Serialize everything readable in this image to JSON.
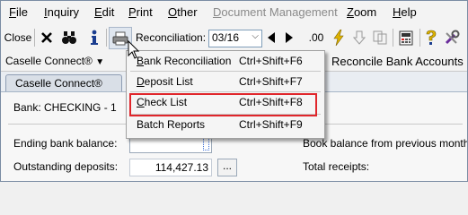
{
  "menubar": {
    "items": [
      {
        "label": "File",
        "u": "F",
        "rest": "ile"
      },
      {
        "label": "Inquiry",
        "u": "I",
        "rest": "nquiry"
      },
      {
        "label": "Edit",
        "u": "E",
        "rest": "dit"
      },
      {
        "label": "Print",
        "u": "P",
        "rest": "rint"
      },
      {
        "label": "Other",
        "u": "O",
        "rest": "ther"
      },
      {
        "label": "Document Management",
        "u": "D",
        "rest": "ocument Management"
      },
      {
        "label": "Zoom",
        "u": "Z",
        "rest": "oom"
      },
      {
        "label": "Help",
        "u": "H",
        "rest": "elp"
      }
    ]
  },
  "toolbar": {
    "close_label": "Close",
    "reconciliation_label": "Reconciliation:",
    "reconciliation_value": "03/16",
    "decimal_label": ".00"
  },
  "row3": {
    "caselle_connect_label": "Caselle Connect®",
    "reconcile_bank_accounts_label": "Reconcile Bank Accounts"
  },
  "tab": {
    "label": "Caselle Connect®"
  },
  "content": {
    "bank_label": "Bank:  CHECKING - 1",
    "ending_balance_label": "Ending bank balance:",
    "outstanding_deposits_label": "Outstanding deposits:",
    "outstanding_deposits_value": "114,427.13",
    "ellipsis_label": "...",
    "book_balance_label": "Book balance from previous month:",
    "total_receipts_label": "Total receipts:"
  },
  "dropdown": {
    "items": [
      {
        "u": "B",
        "rest": "ank Reconciliation",
        "shortcut": "Ctrl+Shift+F6"
      },
      {
        "u": "D",
        "rest": "eposit List",
        "shortcut": "Ctrl+Shift+F7"
      },
      {
        "u": "C",
        "rest": "heck List",
        "shortcut": "Ctrl+Shift+F8"
      },
      {
        "u": "",
        "rest": "Batch Reports",
        "shortcut": "Ctrl+Shift+F9"
      }
    ]
  },
  "colors": {
    "highlight_border": "#e0262b",
    "icon_blue": "#1a3d8f",
    "lightning": "#e0b400"
  }
}
